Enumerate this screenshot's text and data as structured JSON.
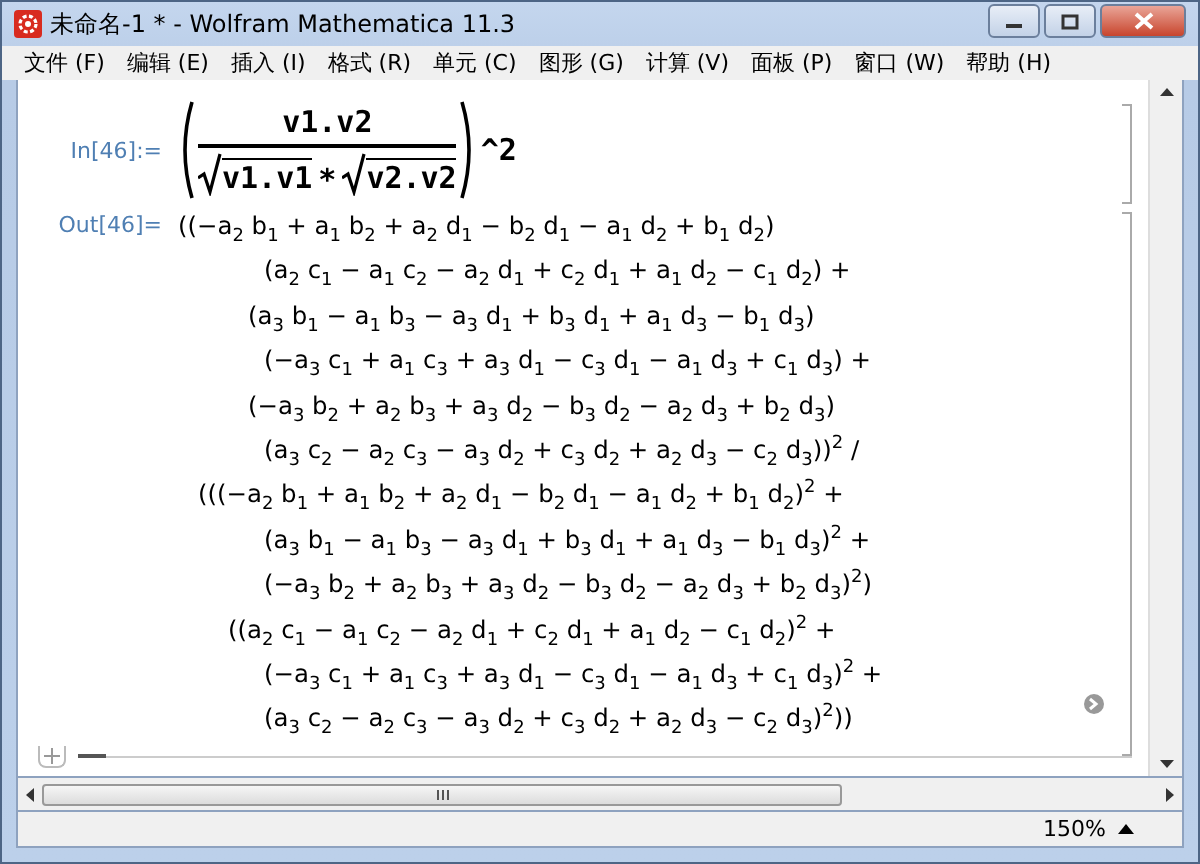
{
  "window": {
    "title": "未命名-1 * - Wolfram Mathematica 11.3"
  },
  "menu": [
    "文件 (F)",
    "编辑 (E)",
    "插入 (I)",
    "格式 (R)",
    "单元 (C)",
    "图形 (G)",
    "计算 (V)",
    "面板 (P)",
    "窗口 (W)",
    "帮助 (H)"
  ],
  "input_cell": {
    "label": "In[46]:=",
    "numerator": "v1.v2",
    "denominator_left": "v1.v1",
    "operator": "*",
    "denominator_right": "v2.v2",
    "power": "^2"
  },
  "output_cell": {
    "label": "Out[46]=",
    "lines": [
      {
        "kind": "lead",
        "text": "((−a$_{2}$ b$_{1}$ + a$_{1}$ b$_{2}$ + a$_{2}$ d$_{1}$ − b$_{2}$ d$_{1}$ − a$_{1}$ d$_{2}$ + b$_{1}$ d$_{2}$)"
      },
      {
        "kind": "factor",
        "text": "(a$_{2}$ c$_{1}$ − a$_{1}$ c$_{2}$ − a$_{2}$ d$_{1}$ + c$_{2}$ d$_{1}$ + a$_{1}$ d$_{2}$ − c$_{1}$ d$_{2}$) +"
      },
      {
        "kind": "term",
        "text": "(a$_{3}$ b$_{1}$ − a$_{1}$ b$_{3}$ − a$_{3}$ d$_{1}$ + b$_{3}$ d$_{1}$ + a$_{1}$ d$_{3}$ − b$_{1}$ d$_{3}$)"
      },
      {
        "kind": "factor",
        "text": "(−a$_{3}$ c$_{1}$ + a$_{1}$ c$_{3}$ + a$_{3}$ d$_{1}$ − c$_{3}$ d$_{1}$ − a$_{1}$ d$_{3}$ + c$_{1}$ d$_{3}$) +"
      },
      {
        "kind": "term",
        "text": "(−a$_{3}$ b$_{2}$ + a$_{2}$ b$_{3}$ + a$_{3}$ d$_{2}$ − b$_{3}$ d$_{2}$ − a$_{2}$ d$_{3}$ + b$_{2}$ d$_{3}$)"
      },
      {
        "kind": "factor",
        "text": "(a$_{3}$ c$_{2}$ − a$_{2}$ c$_{3}$ − a$_{3}$ d$_{2}$ + c$_{3}$ d$_{2}$ + a$_{2}$ d$_{3}$ − c$_{2}$ d$_{3}$))$^{2}$ /"
      },
      {
        "kind": "group",
        "text": "(((−a$_{2}$ b$_{1}$ + a$_{1}$ b$_{2}$ + a$_{2}$ d$_{1}$ − b$_{2}$ d$_{1}$ − a$_{1}$ d$_{2}$ + b$_{1}$ d$_{2}$)$^{2}$ +"
      },
      {
        "kind": "factor",
        "text": "(a$_{3}$ b$_{1}$ − a$_{1}$ b$_{3}$ − a$_{3}$ d$_{1}$ + b$_{3}$ d$_{1}$ + a$_{1}$ d$_{3}$ − b$_{1}$ d$_{3}$)$^{2}$ +"
      },
      {
        "kind": "factor",
        "text": "(−a$_{3}$ b$_{2}$ + a$_{2}$ b$_{3}$ + a$_{3}$ d$_{2}$ − b$_{3}$ d$_{2}$ − a$_{2}$ d$_{3}$ + b$_{2}$ d$_{3}$)$^{2}$)"
      },
      {
        "kind": "subgroup",
        "text": "((a$_{2}$ c$_{1}$ − a$_{1}$ c$_{2}$ − a$_{2}$ d$_{1}$ + c$_{2}$ d$_{1}$ + a$_{1}$ d$_{2}$ − c$_{1}$ d$_{2}$)$^{2}$ +"
      },
      {
        "kind": "factor",
        "text": "(−a$_{3}$ c$_{1}$ + a$_{1}$ c$_{3}$ + a$_{3}$ d$_{1}$ − c$_{3}$ d$_{1}$ − a$_{1}$ d$_{3}$ + c$_{1}$ d$_{3}$)$^{2}$ +"
      },
      {
        "kind": "factor",
        "text": "(a$_{3}$ c$_{2}$ − a$_{2}$ c$_{3}$ − a$_{3}$ d$_{2}$ + c$_{3}$ d$_{2}$ + a$_{2}$ d$_{3}$ − c$_{2}$ d$_{3}$)$^{2}$))"
      }
    ]
  },
  "status_bar": {
    "zoom": "150%"
  }
}
